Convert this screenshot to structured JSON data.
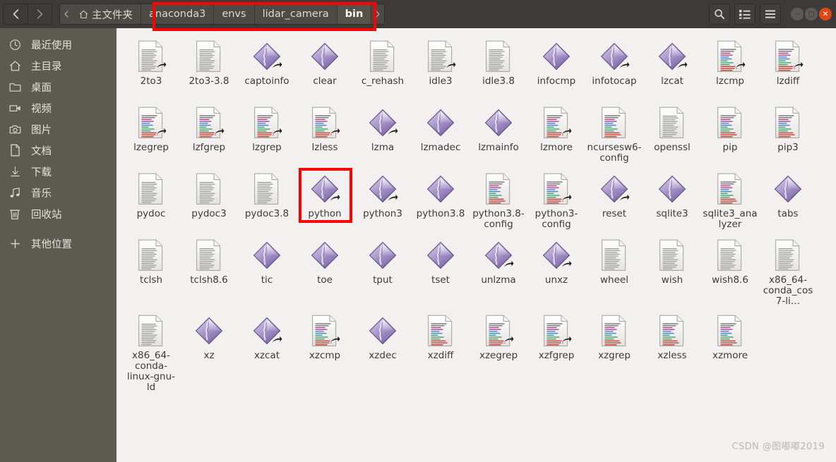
{
  "window": {
    "nav": {
      "back_label": "‹",
      "forward_label": "›",
      "prev_label": "‹",
      "next_label": "›"
    },
    "breadcrumbs": [
      {
        "label": "主文件夹",
        "icon": "home-icon",
        "active": false
      },
      {
        "label": "anaconda3",
        "active": false
      },
      {
        "label": "envs",
        "active": false
      },
      {
        "label": "lidar_camera",
        "active": false
      },
      {
        "label": "bin",
        "active": true
      }
    ],
    "toolbar_right": [
      {
        "name": "search-button",
        "icon": "search-icon"
      },
      {
        "name": "view-list-button",
        "icon": "list-view-icon"
      },
      {
        "name": "menu-button",
        "icon": "hamburger-menu-icon"
      }
    ],
    "controls": [
      {
        "name": "minimize-button",
        "glyph": "−"
      },
      {
        "name": "maximize-button",
        "glyph": "□"
      },
      {
        "name": "close-button",
        "glyph": "✕"
      }
    ]
  },
  "sidebar": {
    "items": [
      {
        "label": "最近使用",
        "icon": "clock-icon",
        "name": "sidebar-item-recent"
      },
      {
        "label": "主目录",
        "icon": "home-icon",
        "name": "sidebar-item-home"
      },
      {
        "label": "桌面",
        "icon": "folder-icon",
        "name": "sidebar-item-desktop"
      },
      {
        "label": "视频",
        "icon": "video-icon",
        "name": "sidebar-item-videos"
      },
      {
        "label": "图片",
        "icon": "camera-icon",
        "name": "sidebar-item-pictures"
      },
      {
        "label": "文档",
        "icon": "document-icon",
        "name": "sidebar-item-documents"
      },
      {
        "label": "下载",
        "icon": "download-icon",
        "name": "sidebar-item-downloads"
      },
      {
        "label": "音乐",
        "icon": "music-icon",
        "name": "sidebar-item-music"
      },
      {
        "label": "回收站",
        "icon": "trash-icon",
        "name": "sidebar-item-trash"
      },
      {
        "label": "其他位置",
        "icon": "plus-icon",
        "name": "sidebar-item-other-locations",
        "gap": true
      }
    ]
  },
  "files": [
    {
      "name": "2to3",
      "type": "doc-link"
    },
    {
      "name": "2to3-3.8",
      "type": "doc-plain"
    },
    {
      "name": "captoinfo",
      "type": "exec-link"
    },
    {
      "name": "clear",
      "type": "exec"
    },
    {
      "name": "c_rehash",
      "type": "doc-plain"
    },
    {
      "name": "idle3",
      "type": "doc-link"
    },
    {
      "name": "idle3.8",
      "type": "doc-plain"
    },
    {
      "name": "infocmp",
      "type": "exec"
    },
    {
      "name": "infotocap",
      "type": "exec-link"
    },
    {
      "name": "lzcat",
      "type": "exec-link"
    },
    {
      "name": "lzcmp",
      "type": "script-link"
    },
    {
      "name": "lzdiff",
      "type": "script-link"
    },
    {
      "name": "lzegrep",
      "type": "script-link"
    },
    {
      "name": "lzfgrep",
      "type": "script-link"
    },
    {
      "name": "lzgrep",
      "type": "script-link"
    },
    {
      "name": "lzless",
      "type": "script-link"
    },
    {
      "name": "lzma",
      "type": "exec-link"
    },
    {
      "name": "lzmadec",
      "type": "exec"
    },
    {
      "name": "lzmainfo",
      "type": "exec"
    },
    {
      "name": "lzmore",
      "type": "script-link"
    },
    {
      "name": "ncursesw6-config",
      "type": "script"
    },
    {
      "name": "openssl",
      "type": "doc-plain"
    },
    {
      "name": "pip",
      "type": "script"
    },
    {
      "name": "pip3",
      "type": "script"
    },
    {
      "name": "pydoc",
      "type": "doc-plain"
    },
    {
      "name": "pydoc3",
      "type": "doc-plain"
    },
    {
      "name": "pydoc3.8",
      "type": "doc-plain"
    },
    {
      "name": "python",
      "type": "exec-link",
      "selected": true
    },
    {
      "name": "python3",
      "type": "exec-link"
    },
    {
      "name": "python3.8",
      "type": "exec"
    },
    {
      "name": "python3.8-config",
      "type": "script"
    },
    {
      "name": "python3-config",
      "type": "script-link"
    },
    {
      "name": "reset",
      "type": "exec-link"
    },
    {
      "name": "sqlite3",
      "type": "exec"
    },
    {
      "name": "sqlite3_analyzer",
      "type": "script"
    },
    {
      "name": "tabs",
      "type": "exec"
    },
    {
      "name": "tclsh",
      "type": "doc-plain"
    },
    {
      "name": "tclsh8.6",
      "type": "doc-plain"
    },
    {
      "name": "tic",
      "type": "exec"
    },
    {
      "name": "toe",
      "type": "exec"
    },
    {
      "name": "tput",
      "type": "exec"
    },
    {
      "name": "tset",
      "type": "exec"
    },
    {
      "name": "unlzma",
      "type": "exec-link"
    },
    {
      "name": "unxz",
      "type": "exec-link"
    },
    {
      "name": "wheel",
      "type": "doc-plain"
    },
    {
      "name": "wish",
      "type": "doc-plain"
    },
    {
      "name": "wish8.6",
      "type": "doc-plain"
    },
    {
      "name": "x86_64-conda_cos7-li…",
      "type": "doc-plain"
    },
    {
      "name": "x86_64-conda-linux-gnu-ld",
      "type": "doc-plain"
    },
    {
      "name": "xz",
      "type": "exec"
    },
    {
      "name": "xzcat",
      "type": "exec-link"
    },
    {
      "name": "xzcmp",
      "type": "script-link"
    },
    {
      "name": "xzdec",
      "type": "exec"
    },
    {
      "name": "xzdiff",
      "type": "script"
    },
    {
      "name": "xzegrep",
      "type": "script-link"
    },
    {
      "name": "xzfgrep",
      "type": "script-link"
    },
    {
      "name": "xzgrep",
      "type": "script"
    },
    {
      "name": "xzless",
      "type": "script"
    },
    {
      "name": "xzmore",
      "type": "script"
    }
  ],
  "watermark": "CSDN @图嘟嘟2019",
  "colors": {
    "titlebar": "#3c3b37",
    "sidebar": "#5d5a50",
    "content": "#f2f1ef",
    "accent_close": "#dd4814",
    "annotation": "#ff0000",
    "exec_icon": "#a08fc4"
  }
}
